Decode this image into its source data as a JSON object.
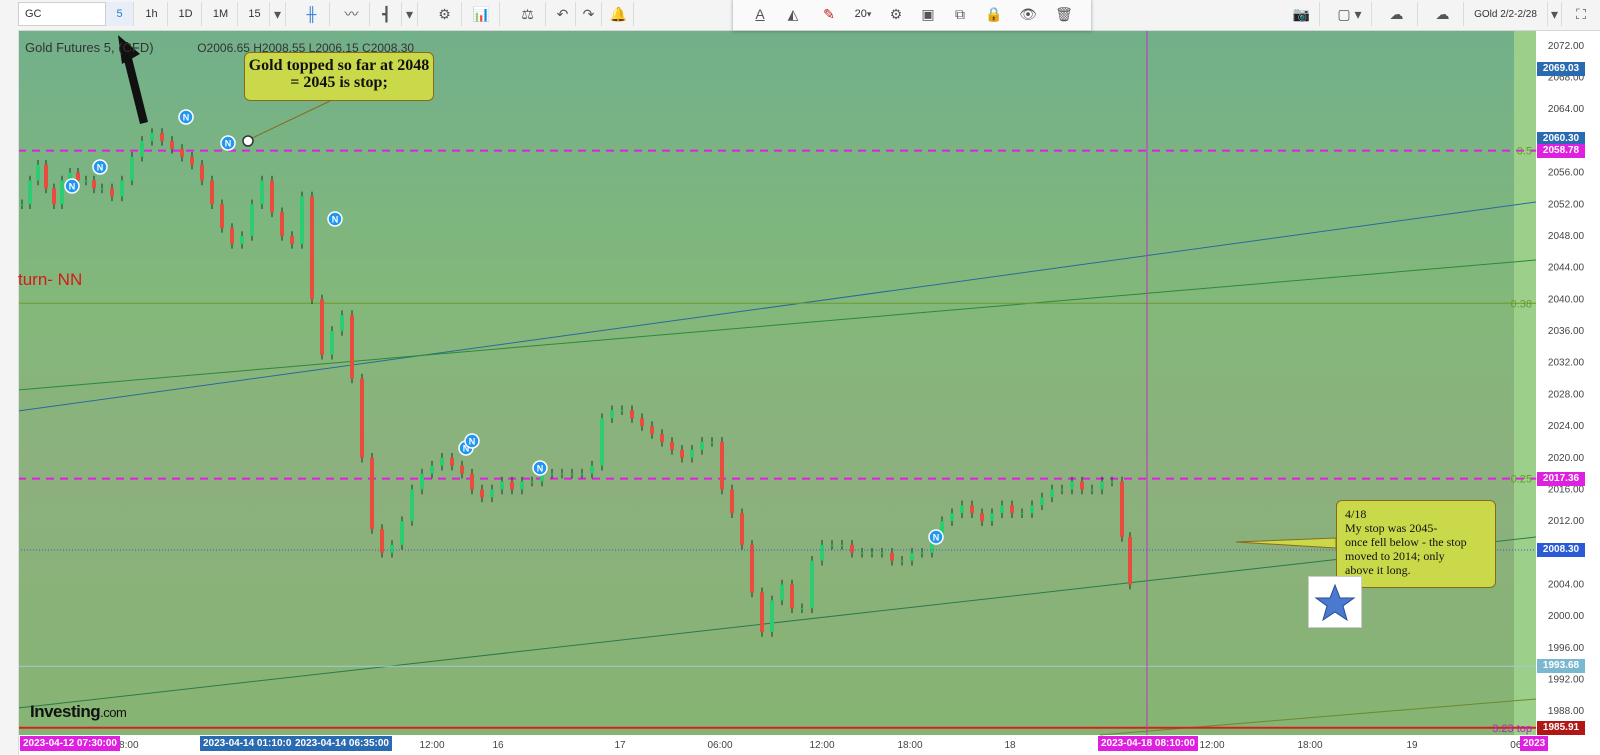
{
  "toolbar": {
    "symbol": "GC",
    "intervals": [
      "5",
      "1h",
      "1D",
      "1M",
      "15"
    ],
    "active_interval": "5",
    "icons": [
      "candles-icon",
      "line-chart-icon",
      "bar-type-icon",
      "settings-icon",
      "indicators-icon",
      "compare-icon",
      "undo-icon",
      "redo-icon",
      "alert-icon"
    ],
    "camera_icon": "camera-icon",
    "layout_name": "GOld 2/2-2/28",
    "font_size": "20"
  },
  "legend": {
    "title": "Gold Futures 5, (CFD)",
    "ohlc": "O2006.65 H2008.55 L2006.15 C2008.30"
  },
  "annotations": {
    "callout_top": "Gold topped so far at 2048 = 2045 is stop;",
    "callout_right_lines": [
      "4/18",
      " My stop was 2045-",
      "once fell below - the stop",
      " moved to 2014; only",
      " above it long."
    ],
    "red_text": "turn- NN",
    "logo_main": "Investing",
    "logo_suffix": ".com"
  },
  "colors": {
    "bg_top": "#72b08a",
    "bg_mid": "#84b87a",
    "fib_line": "#e020e0",
    "up_candle": "#2ecc71",
    "down_candle": "#e74c3c",
    "cursor_line": "#c030c0",
    "price_tag": "#2a5ad6",
    "magenta_tag": "#e020e0"
  },
  "chart_data": {
    "type": "line",
    "title": "Gold Futures 5, (CFD)",
    "ylim": [
      1985,
      2074
    ],
    "y_ticks": [
      1988,
      1992,
      1996,
      2000,
      2004,
      2008,
      2012,
      2016,
      2020,
      2024,
      2028,
      2032,
      2036,
      2040,
      2044,
      2048,
      2052,
      2056,
      2060,
      2064,
      2068,
      2072
    ],
    "x_tick_labels": [
      "18:00",
      "12:00",
      "16",
      "17",
      "06:00",
      "12:00",
      "18:00",
      "18",
      "12:00",
      "18:00",
      "19",
      "06:0"
    ],
    "fib_levels": [
      {
        "label": "0.5",
        "value": 2058.78
      },
      {
        "label": "0.38",
        "value": 2039.5
      },
      {
        "label": "0.25",
        "value": 2017.36
      },
      {
        "label": "3.23 top",
        "value": 1985.91
      }
    ],
    "price_tags": [
      {
        "value": 2069.03,
        "text": "2069.03"
      },
      {
        "value": 2060.3,
        "text": "2060.30"
      },
      {
        "value": 2058.78,
        "text": "2058.78"
      },
      {
        "value": 2017.36,
        "text": "2017.36"
      },
      {
        "value": 2008.3,
        "text": "2008.30"
      },
      {
        "value": 1993.68,
        "text": "1993.68"
      },
      {
        "value": 1985.91,
        "text": "1985.91"
      }
    ],
    "time_tags": [
      "2023-04-12 07:30:00",
      "2023-04-14 01:10:0(",
      "2023-04-14 06:35:00",
      "2023-04-18 08:10:00",
      "2023"
    ],
    "series": [
      {
        "x": [
          0,
          8,
          16,
          24,
          32,
          40,
          48,
          56,
          64,
          72,
          80,
          90,
          100,
          110,
          120,
          130,
          140,
          150,
          160,
          170,
          180,
          190,
          200,
          210,
          220,
          230,
          240,
          250,
          260,
          270,
          280,
          290,
          300,
          310,
          320,
          330,
          340,
          350,
          360,
          370,
          380,
          390,
          400,
          410,
          420,
          430,
          440,
          450,
          460,
          470,
          480,
          490,
          500,
          510,
          520,
          530,
          540,
          550,
          560,
          570,
          580,
          590,
          600,
          610,
          620,
          630,
          640,
          650,
          660,
          670,
          680,
          690,
          700,
          710,
          720,
          730,
          740,
          750,
          760,
          770,
          780,
          790,
          800,
          810,
          820,
          830,
          840,
          850,
          860,
          870,
          880,
          890,
          900,
          910,
          920,
          930,
          940,
          950,
          960,
          970,
          980,
          990,
          1000,
          1010,
          1020,
          1030,
          1040,
          1050,
          1060,
          1070,
          1080,
          1090,
          1100,
          1108
        ],
        "values": [
          2052,
          2055,
          2057,
          2054,
          2052,
          2055,
          2056,
          2055,
          2055,
          2054,
          2054,
          2053,
          2055,
          2058,
          2060,
          2061,
          2060,
          2059,
          2058,
          2057,
          2055,
          2052,
          2049,
          2047,
          2048,
          2052,
          2055,
          2051,
          2048,
          2047,
          2053,
          2040,
          2033,
          2036,
          2038,
          2030,
          2020,
          2011,
          2008,
          2009,
          2012,
          2016,
          2018,
          2019,
          2020,
          2019,
          2018,
          2016,
          2015,
          2016,
          2017,
          2016,
          2017,
          2017,
          2018,
          2018,
          2018,
          2018,
          2018,
          2019,
          2025,
          2026,
          2026,
          2025,
          2024,
          2023,
          2022,
          2021,
          2020,
          2021,
          2022,
          2022,
          2016,
          2013,
          2009,
          2003,
          1998,
          2002,
          2004,
          2001,
          2001,
          2007,
          2009,
          2009,
          2009,
          2008,
          2008,
          2008,
          2008,
          2007,
          2007,
          2008,
          2008,
          2010,
          2012,
          2013,
          2014,
          2013,
          2012,
          2013,
          2014,
          2013,
          2013,
          2014,
          2015,
          2016,
          2016,
          2017,
          2016,
          2016,
          2017,
          2017,
          2010,
          2004
        ]
      }
    ],
    "news_markers": 9
  }
}
